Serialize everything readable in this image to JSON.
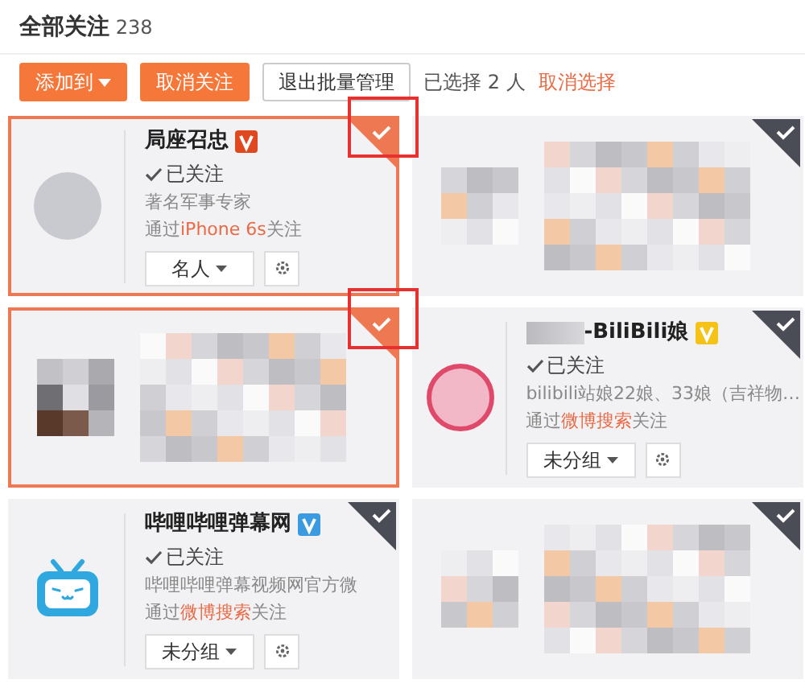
{
  "header": {
    "title": "全部关注",
    "count": "238"
  },
  "toolbar": {
    "buttons": [
      {
        "label": "添加到",
        "kind": "dropdown"
      },
      {
        "label": "取消关注",
        "kind": "primary"
      },
      {
        "label": "退出批量管理",
        "kind": "secondary"
      }
    ],
    "selection_text": "已选择 2 人",
    "clear_link": "取消选择"
  },
  "cards": [
    {
      "kind": "profile",
      "selected": true,
      "highlighted": true,
      "avatar": {
        "kind": "photo"
      },
      "name": "局座召忠",
      "name_blurred": false,
      "color": "#e0481f",
      "status": "已关注",
      "description": "著名军事专家",
      "via_prefix": "通过",
      "via_source": "iPhone 6s",
      "via_suffix": "关注",
      "group": "名人"
    },
    {
      "kind": "pixelated",
      "selected": false,
      "highlighted": false
    },
    {
      "kind": "pixelated",
      "selected": true,
      "highlighted": true
    },
    {
      "kind": "profile",
      "selected": false,
      "highlighted": false,
      "avatar": {
        "kind": "illustration"
      },
      "name": "-BiliBili娘",
      "name_blurred": true,
      "color": "#f5c218",
      "status": "已关注",
      "description": "bilibili站娘22娘、33娘（吉祥物…",
      "via_prefix": "通过",
      "via_source": "微博搜索",
      "via_suffix": "关注",
      "group": "未分组"
    },
    {
      "kind": "profile",
      "selected": false,
      "highlighted": false,
      "avatar": {
        "kind": "tv-logo"
      },
      "name": "哔哩哔哩弹幕网",
      "name_blurred": false,
      "color": "#3a9be0",
      "status": "已关注",
      "description": "哔哩哔哩弹幕视频网官方微",
      "via_prefix": "通过",
      "via_source": "微博搜索",
      "via_suffix": "关注",
      "group": "未分组"
    },
    {
      "kind": "pixelated",
      "selected": false,
      "highlighted": false
    }
  ]
}
